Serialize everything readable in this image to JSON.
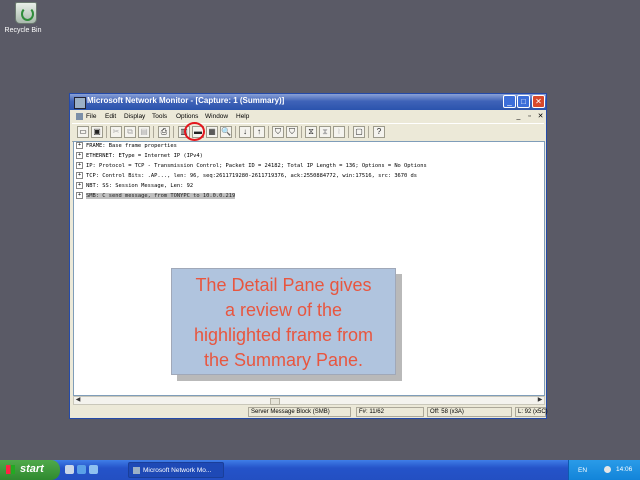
{
  "desktop": {
    "recycle_bin_label": "Recycle Bin"
  },
  "window": {
    "title": "Microsoft Network Monitor - [Capture: 1 (Summary)]",
    "controls": {
      "min": "_",
      "max": "□",
      "close": "✕"
    },
    "menu": [
      "File",
      "Edit",
      "Display",
      "Tools",
      "Options",
      "Window",
      "Help"
    ],
    "mdi_controls": {
      "min": "_",
      "restore": "▫",
      "close": "✕"
    }
  },
  "toolbar_glyphs": [
    "▭",
    "▣",
    "✂",
    "⧉",
    "▤",
    "⎙",
    "▥",
    "▬",
    "▦",
    "🔍",
    "↓",
    "↑",
    "⛉",
    "⛉",
    "⧖",
    "⧗",
    "⧘",
    "▢",
    "?"
  ],
  "detail_pane": {
    "rows": [
      {
        "text": "FRAME: Base frame properties",
        "selected": false
      },
      {
        "text": "ETHERNET:  EType = Internet IP (IPv4)",
        "selected": false
      },
      {
        "text": "IP: Protocol = TCP - Transmission Control; Packet ID = 24182; Total IP Length = 136; Options = No Options",
        "selected": false
      },
      {
        "text": "TCP: Control Bits: .AP..., len:   96, seq:2611719280-2611719376, ack:2550884772, win:17516, src: 3670  ds",
        "selected": false
      },
      {
        "text": "NBT: SS: Session Message, Len: 92",
        "selected": false
      },
      {
        "text": "SMB: C send message, from TONYPC to 10.0.0.219",
        "selected": true
      }
    ]
  },
  "callout": {
    "lines": [
      "The Detail Pane gives",
      "a review of the",
      "highlighted frame from",
      "the Summary Pane."
    ]
  },
  "status_bar": {
    "protocol": "Server Message Block (SMB)",
    "frame": "F#: 11/62",
    "offset": "Off: 58 (x3A)",
    "length": "L: 92 (x5C)"
  },
  "taskbar": {
    "start_label": "start",
    "task_label": "Microsoft Network Mo...",
    "language": "EN",
    "clock": "14:06"
  }
}
